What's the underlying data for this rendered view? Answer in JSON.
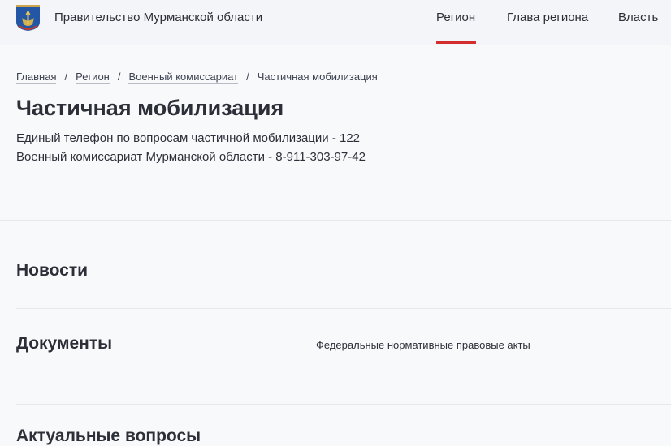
{
  "header": {
    "site_title": "Правительство Мурманской области",
    "nav": [
      {
        "label": "Регион",
        "active": true
      },
      {
        "label": "Глава региона",
        "active": false
      },
      {
        "label": "Власть",
        "active": false
      }
    ],
    "accent_color": "#d42f2f",
    "logo_icon": "coat-of-arms-icon"
  },
  "breadcrumb": {
    "items": [
      "Главная",
      "Регион",
      "Военный комиссариат"
    ],
    "current": "Частичная мобилизация",
    "separator": "/"
  },
  "page": {
    "title": "Частичная мобилизация",
    "info": [
      "Единый телефон по вопросам частичной мобилизации - 122",
      "Военный комиссариат Мурманской области - 8-911-303-97-42"
    ]
  },
  "sections": {
    "news": {
      "title": "Новости"
    },
    "documents": {
      "title": "Документы",
      "links": [
        "Федеральные нормативные правовые акты"
      ]
    },
    "faq": {
      "title": "Актуальные вопросы"
    }
  }
}
